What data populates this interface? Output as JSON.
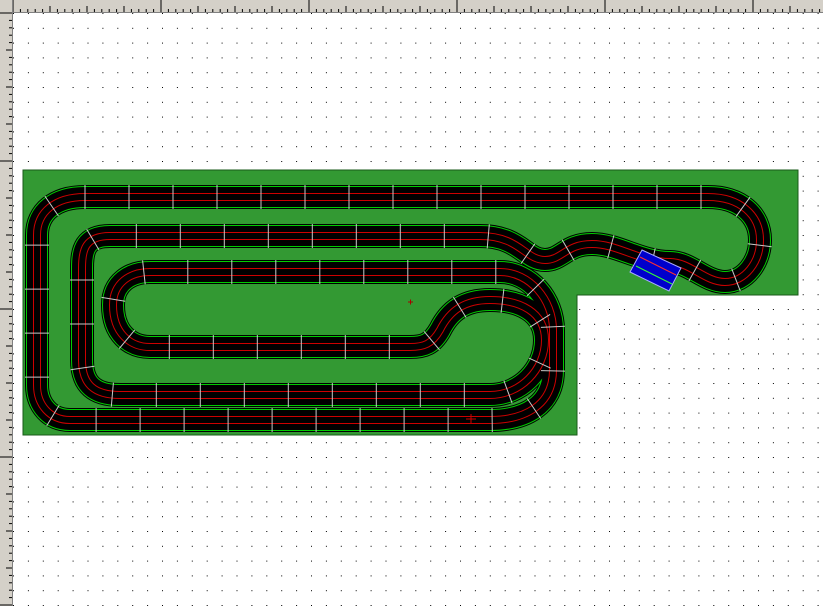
{
  "canvas": {
    "background": "#ffffff",
    "grid_dot_color": "#000000",
    "baseboard_color": "#339933",
    "track_color": "#000000",
    "lane_color_outer": "#00cc00",
    "lane_color_inner": "#cc0000",
    "joint_color": "#c8c8c8",
    "selected_piece_color": "#0000cc"
  },
  "icons": {
    "origin_marker": "crosshair-icon",
    "center_marker": "small-cross-icon"
  }
}
